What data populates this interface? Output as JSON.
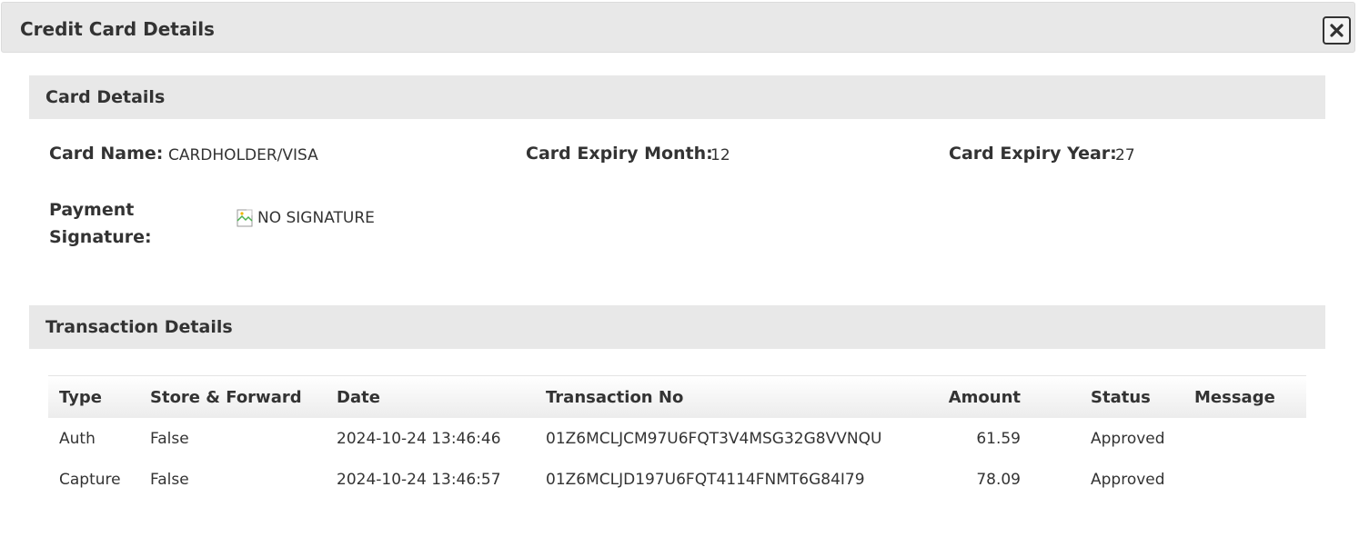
{
  "dialog": {
    "title": "Credit Card Details"
  },
  "card_section": {
    "header": "Card Details",
    "card_name_label": "Card Name:",
    "card_name_value": "CARDHOLDER/VISA",
    "expiry_month_label": "Card Expiry Month:",
    "expiry_month_value": "12",
    "expiry_year_label": "Card Expiry Year:",
    "expiry_year_value": "27",
    "signature_label_line1": "Payment",
    "signature_label_line2": "Signature:",
    "signature_alt": "NO SIGNATURE"
  },
  "transaction_section": {
    "header": "Transaction Details",
    "columns": [
      "Type",
      "Store & Forward",
      "Date",
      "Transaction No",
      "Amount",
      "Status",
      "Message"
    ],
    "rows": [
      {
        "type": "Auth",
        "store_forward": "False",
        "date": "2024-10-24 13:46:46",
        "transaction_no": "01Z6MCLJCM97U6FQT3V4MSG32G8VVNQU",
        "amount": "61.59",
        "status": "Approved",
        "message": ""
      },
      {
        "type": "Capture",
        "store_forward": "False",
        "date": "2024-10-24 13:46:57",
        "transaction_no": "01Z6MCLJD197U6FQT4114FNMT6G84I79",
        "amount": "78.09",
        "status": "Approved",
        "message": ""
      }
    ]
  },
  "icons": {
    "close": "close-icon",
    "broken_image": "broken-image-icon"
  },
  "colors": {
    "header_bg": "#e8e8e8",
    "text": "#333333",
    "background": "#ffffff"
  }
}
